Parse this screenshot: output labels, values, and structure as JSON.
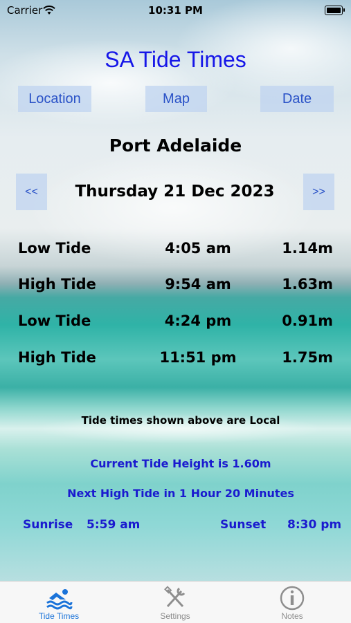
{
  "status_bar": {
    "carrier": "Carrier",
    "time": "10:31 PM"
  },
  "app": {
    "title": "SA Tide Times"
  },
  "nav_buttons": {
    "location": "Location",
    "map": "Map",
    "date": "Date"
  },
  "location_name": "Port Adelaide",
  "date_nav": {
    "prev": "<<",
    "date": "Thursday 21 Dec 2023",
    "next": ">>"
  },
  "tides": [
    {
      "type": "Low Tide",
      "time": "4:05 am",
      "height": "1.14m"
    },
    {
      "type": "High Tide",
      "time": "9:54 am",
      "height": "1.63m"
    },
    {
      "type": "Low Tide",
      "time": "4:24 pm",
      "height": "0.91m"
    },
    {
      "type": "High Tide",
      "time": "11:51 pm",
      "height": "1.75m"
    }
  ],
  "note": "Tide times shown above are Local",
  "current_height": "Current Tide Height is 1.60m",
  "next_high": "Next High Tide in 1 Hour 20 Minutes",
  "sun": {
    "sunrise_label": "Sunrise",
    "sunrise_time": "5:59 am",
    "sunset_label": "Sunset",
    "sunset_time": "8:30 pm"
  },
  "tab_bar": {
    "tabs": [
      {
        "label": "Tide Times",
        "icon": "swimmer-icon",
        "active": true
      },
      {
        "label": "Settings",
        "icon": "tools-icon",
        "active": false
      },
      {
        "label": "Notes",
        "icon": "info-icon",
        "active": false
      }
    ]
  },
  "colors": {
    "accent": "#1a1acf",
    "title": "#1616e8",
    "button_text": "#2a52c7",
    "tab_active": "#1a73d9",
    "tab_inactive": "#8e8e8e"
  }
}
